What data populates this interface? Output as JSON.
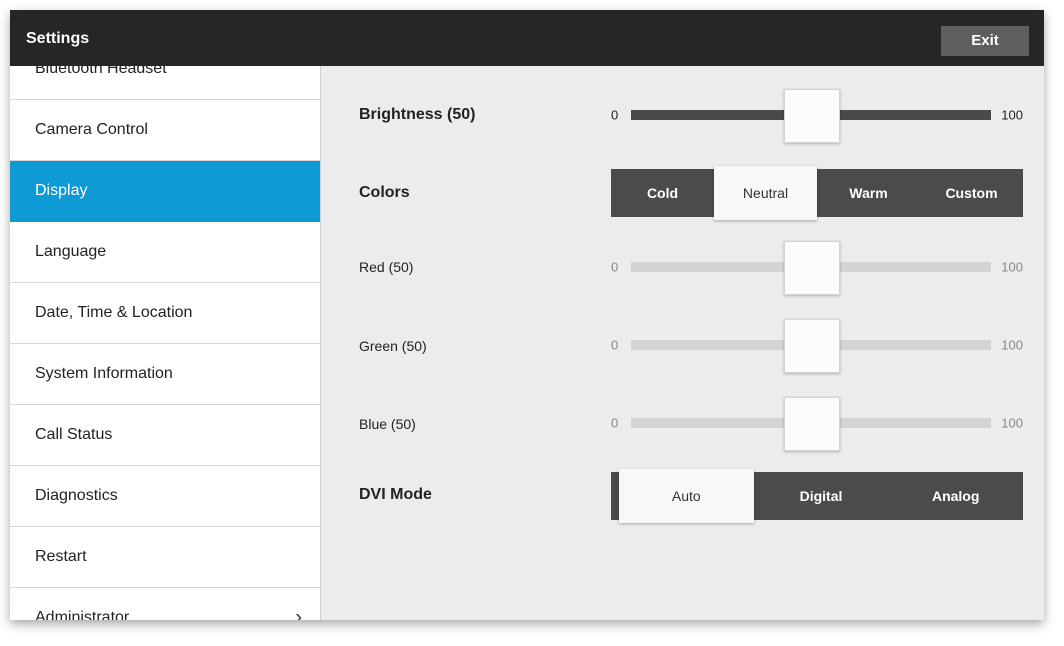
{
  "header": {
    "title": "Settings",
    "exit_label": "Exit"
  },
  "sidebar": {
    "items": [
      {
        "label": "Bluetooth Headset"
      },
      {
        "label": "Camera Control"
      },
      {
        "label": "Display",
        "active": true
      },
      {
        "label": "Language"
      },
      {
        "label": "Date, Time & Location"
      },
      {
        "label": "System Information"
      },
      {
        "label": "Call Status"
      },
      {
        "label": "Diagnostics"
      },
      {
        "label": "Restart"
      },
      {
        "label": "Administrator",
        "chevron": "chevron-right-icon"
      }
    ]
  },
  "display": {
    "brightness": {
      "label": "Brightness (50)",
      "min": "0",
      "max": "100",
      "value": 50
    },
    "colors": {
      "label": "Colors",
      "options": [
        "Cold",
        "Neutral",
        "Warm",
        "Custom"
      ],
      "selected": "Neutral"
    },
    "red": {
      "label": "Red (50)",
      "min": "0",
      "max": "100",
      "value": 50
    },
    "green": {
      "label": "Green (50)",
      "min": "0",
      "max": "100",
      "value": 50
    },
    "blue": {
      "label": "Blue (50)",
      "min": "0",
      "max": "100",
      "value": 50
    },
    "dvi_mode": {
      "label": "DVI Mode",
      "options": [
        "Auto",
        "Digital",
        "Analog"
      ],
      "selected": "Auto"
    }
  },
  "colors": {
    "accent": "#0e9ad5",
    "titlebar": "#262626"
  }
}
